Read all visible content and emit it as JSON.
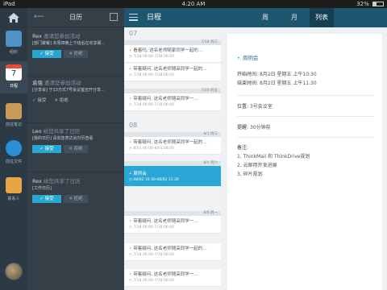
{
  "status_bar": {
    "device": "iPad",
    "time": "4:20 AM",
    "battery": "32%",
    "battery_level": 0.32
  },
  "left_nav": {
    "items": [
      {
        "label": "组织",
        "icon": "org-icon",
        "color": "#4f93c4"
      },
      {
        "label": "日程",
        "icon": "calendar-icon",
        "color": "#e74c3c",
        "day": "7"
      },
      {
        "label": "前往笔记",
        "icon": "notes-icon",
        "color": "#c99a55"
      },
      {
        "label": "前往文件",
        "icon": "files-icon",
        "color": "#2a8fd4"
      },
      {
        "label": "联系人",
        "icon": "contacts-icon",
        "color": "#e7a543"
      }
    ]
  },
  "activity": {
    "title": "日历",
    "items": [
      {
        "name": "Rex",
        "action": "邀请您参加活动",
        "desc": "[部门聚餐] 本周四晚上下班后在欢享阁…",
        "accept": "✓ 接受",
        "reject": "✕ 拒绝",
        "style": "buttons"
      },
      {
        "name": "袁强",
        "action": "邀请您参加活动",
        "desc": "[分享会] 于13方式7号会议室召开分享…",
        "accept": "✓ 接受",
        "reject": "✕ 拒绝",
        "style": "plain"
      },
      {
        "name": "Leo",
        "action": "给您共享了日历",
        "desc": "[我的日历] 请向您表达出日历查看",
        "accept": "✓ 接受",
        "reject": "✕ 拒绝",
        "style": "buttons"
      },
      {
        "name": "Rex",
        "action": "给您共享了日历",
        "desc": "[工作日历]",
        "accept": "✓ 接受",
        "reject": "✕ 拒绝",
        "style": "buttons"
      }
    ]
  },
  "schedule": {
    "title": "日程",
    "months": [
      "07",
      "08"
    ],
    "day_heads": [
      "7/18 周三",
      "7/20 周五",
      "8/1 周三",
      "8/4 周六",
      "8/6 周一"
    ],
    "events": [
      {
        "title": "看着吗, 这名老师随家同学一起的…",
        "time": "7/18 06:00-7/18 06:00"
      },
      {
        "title": "带着疑问, 这名老师随采同学一起的…",
        "time": "7/18 06:00-7/18 06:00"
      },
      {
        "title": "带着疑问, 这名老师随采同学一…",
        "time": "7/18 06:00-7/18 06:00"
      },
      {
        "title": "带着疑问, 这名老师随采同学一起的…",
        "time": "8/01 06:00-8/01 08:00"
      },
      {
        "title": "周例会",
        "time": "08/02 10:30-08/02 11:30"
      },
      {
        "title": "带着疑问, 这名老师随采同学一…",
        "time": "7/18 06:00-7/18 06:00"
      },
      {
        "title": "带着疑问, 这名老师随采同学一起的…",
        "time": "7/18 06:00-7/18 06:00"
      },
      {
        "title": "带着疑问, 这名老师随采同学一…",
        "time": "7/18 06:00-7/18 06:00"
      }
    ]
  },
  "view_tabs": [
    "周",
    "月",
    "列表"
  ],
  "active_tab": "列表",
  "detail": {
    "title": "周例会",
    "start_label": "开始时间:",
    "start": "8月2日 星期五 上午10:30",
    "end_label": "结束时间:",
    "end": "8月2日 星期五 上午11:30",
    "location_label": "位置:",
    "location": "3号会议室",
    "remind_label": "提醒:",
    "remind": "30分钟前",
    "notes_label": "备注:",
    "notes": [
      "1, ThinkMail 和 ThinkDrive规划",
      "2, 云邮用开发进展",
      "3, 碎片规划"
    ]
  }
}
